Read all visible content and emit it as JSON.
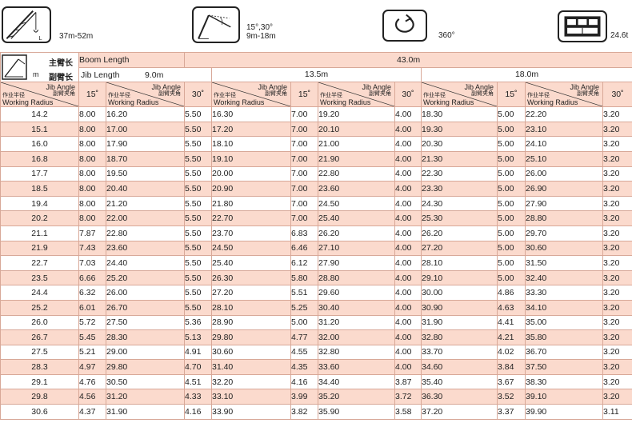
{
  "header": {
    "crane_range": "37m-52m",
    "jib_angles": "15°,30°",
    "jib_lengths": "9m-18m",
    "slew": "360°",
    "counterweight": "24.6t"
  },
  "table": {
    "boom_length_label_cn": "主臂长",
    "boom_length_label_en": "Boom Length",
    "boom_length_value": "43.0m",
    "jib_length_label_cn": "副臂长",
    "jib_length_label_en": "Jib Length",
    "unit_m": "m",
    "jib_lengths": [
      "9.0m",
      "13.5m",
      "18.0m"
    ],
    "head_jib_angle_en": "Jib Angle",
    "head_jib_angle_cn": "副臂夹角",
    "head_radius_cn": "作业半径",
    "head_radius_en": "Working Radius",
    "angle_15": "15˚",
    "angle_30": "30˚",
    "rows": [
      [
        "14.2",
        "8.00",
        "16.20",
        "5.50",
        "16.30",
        "7.00",
        "19.20",
        "4.00",
        "18.30",
        "5.00",
        "22.20",
        "3.20"
      ],
      [
        "15.1",
        "8.00",
        "17.00",
        "5.50",
        "17.20",
        "7.00",
        "20.10",
        "4.00",
        "19.30",
        "5.00",
        "23.10",
        "3.20"
      ],
      [
        "16.0",
        "8.00",
        "17.90",
        "5.50",
        "18.10",
        "7.00",
        "21.00",
        "4.00",
        "20.30",
        "5.00",
        "24.10",
        "3.20"
      ],
      [
        "16.8",
        "8.00",
        "18.70",
        "5.50",
        "19.10",
        "7.00",
        "21.90",
        "4.00",
        "21.30",
        "5.00",
        "25.10",
        "3.20"
      ],
      [
        "17.7",
        "8.00",
        "19.50",
        "5.50",
        "20.00",
        "7.00",
        "22.80",
        "4.00",
        "22.30",
        "5.00",
        "26.00",
        "3.20"
      ],
      [
        "18.5",
        "8.00",
        "20.40",
        "5.50",
        "20.90",
        "7.00",
        "23.60",
        "4.00",
        "23.30",
        "5.00",
        "26.90",
        "3.20"
      ],
      [
        "19.4",
        "8.00",
        "21.20",
        "5.50",
        "21.80",
        "7.00",
        "24.50",
        "4.00",
        "24.30",
        "5.00",
        "27.90",
        "3.20"
      ],
      [
        "20.2",
        "8.00",
        "22.00",
        "5.50",
        "22.70",
        "7.00",
        "25.40",
        "4.00",
        "25.30",
        "5.00",
        "28.80",
        "3.20"
      ],
      [
        "21.1",
        "7.87",
        "22.80",
        "5.50",
        "23.70",
        "6.83",
        "26.20",
        "4.00",
        "26.20",
        "5.00",
        "29.70",
        "3.20"
      ],
      [
        "21.9",
        "7.43",
        "23.60",
        "5.50",
        "24.50",
        "6.46",
        "27.10",
        "4.00",
        "27.20",
        "5.00",
        "30.60",
        "3.20"
      ],
      [
        "22.7",
        "7.03",
        "24.40",
        "5.50",
        "25.40",
        "6.12",
        "27.90",
        "4.00",
        "28.10",
        "5.00",
        "31.50",
        "3.20"
      ],
      [
        "23.5",
        "6.66",
        "25.20",
        "5.50",
        "26.30",
        "5.80",
        "28.80",
        "4.00",
        "29.10",
        "5.00",
        "32.40",
        "3.20"
      ],
      [
        "24.4",
        "6.32",
        "26.00",
        "5.50",
        "27.20",
        "5.51",
        "29.60",
        "4.00",
        "30.00",
        "4.86",
        "33.30",
        "3.20"
      ],
      [
        "25.2",
        "6.01",
        "26.70",
        "5.50",
        "28.10",
        "5.25",
        "30.40",
        "4.00",
        "30.90",
        "4.63",
        "34.10",
        "3.20"
      ],
      [
        "26.0",
        "5.72",
        "27.50",
        "5.36",
        "28.90",
        "5.00",
        "31.20",
        "4.00",
        "31.90",
        "4.41",
        "35.00",
        "3.20"
      ],
      [
        "26.7",
        "5.45",
        "28.30",
        "5.13",
        "29.80",
        "4.77",
        "32.00",
        "4.00",
        "32.80",
        "4.21",
        "35.80",
        "3.20"
      ],
      [
        "27.5",
        "5.21",
        "29.00",
        "4.91",
        "30.60",
        "4.55",
        "32.80",
        "4.00",
        "33.70",
        "4.02",
        "36.70",
        "3.20"
      ],
      [
        "28.3",
        "4.97",
        "29.80",
        "4.70",
        "31.40",
        "4.35",
        "33.60",
        "4.00",
        "34.60",
        "3.84",
        "37.50",
        "3.20"
      ],
      [
        "29.1",
        "4.76",
        "30.50",
        "4.51",
        "32.20",
        "4.16",
        "34.40",
        "3.87",
        "35.40",
        "3.67",
        "38.30",
        "3.20"
      ],
      [
        "29.8",
        "4.56",
        "31.20",
        "4.33",
        "33.10",
        "3.99",
        "35.20",
        "3.72",
        "36.30",
        "3.52",
        "39.10",
        "3.20"
      ],
      [
        "30.6",
        "4.37",
        "31.90",
        "4.16",
        "33.90",
        "3.82",
        "35.90",
        "3.58",
        "37.20",
        "3.37",
        "39.90",
        "3.11"
      ]
    ]
  }
}
